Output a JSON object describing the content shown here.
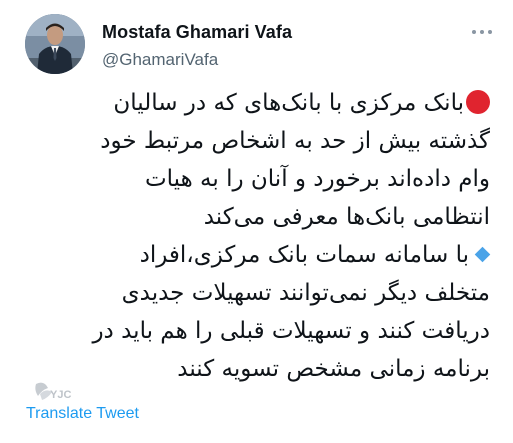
{
  "header": {
    "display_name": "Mostafa Ghamari Vafa",
    "handle": "@GhamariVafa",
    "avatar_icon": "profile-photo",
    "more_icon": "more-dots-icon"
  },
  "tweet": {
    "lines": [
      "بانک مرکزی با بانک‌های که در سالیان",
      "گذشته بیش از حد به اشخاص مرتبط خود",
      "وام داده‌اند برخورد و آنان را به هیات",
      "انتظامی بانک‌ها معرفی می‌کند",
      "با سامانه سمات بانک مرکزی،افراد",
      "متخلف دیگر نمی‌توانند تسهیلات جدیدی",
      "دریافت کنند و تسهیلات قبلی را هم باید در",
      "برنامه زمانی مشخص تسویه کنند"
    ],
    "bullet_colors": {
      "red_circle": "#e0242f",
      "blue_diamond": "#4aa3e8"
    }
  },
  "footer": {
    "translate_label": "Translate Tweet",
    "watermark": "YJC"
  }
}
